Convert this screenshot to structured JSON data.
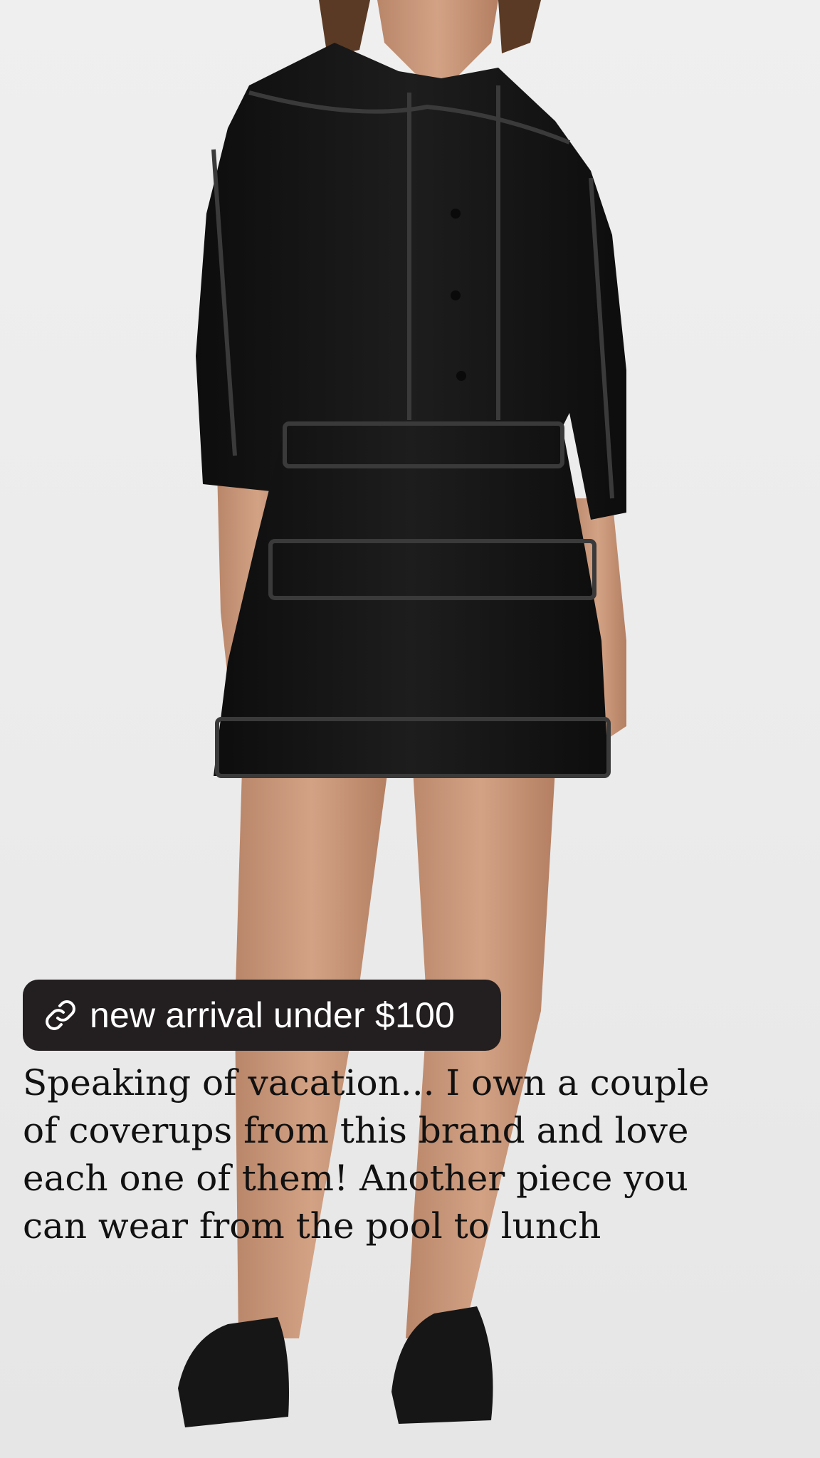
{
  "post": {
    "link_chip": {
      "label": "new arrival under $100",
      "icon": "link-icon",
      "background": "#231f20"
    },
    "caption": "Speaking of vacation... I own a couple of coverups from this brand and love each one of them! Another piece you can wear from the pool to lunch"
  },
  "photo": {
    "subject": "product-photo",
    "colors": {
      "background": "#ececec",
      "dress": "#141414",
      "skin": "#c99778"
    }
  }
}
